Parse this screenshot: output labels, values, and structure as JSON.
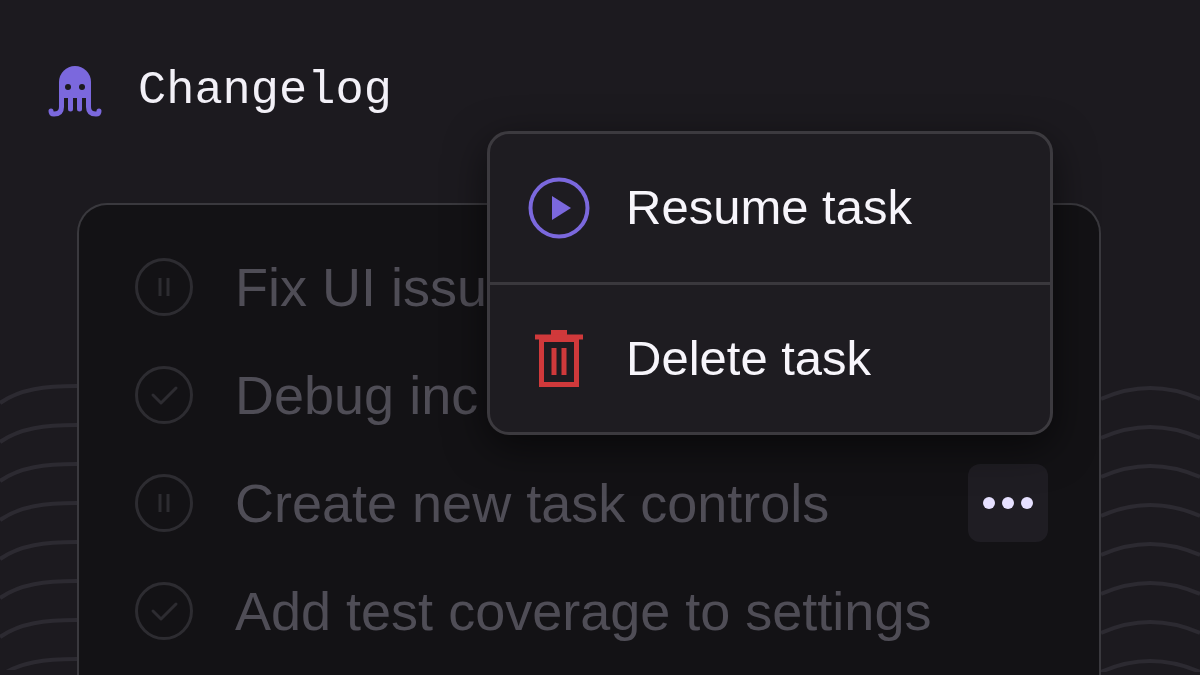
{
  "header": {
    "title": "Changelog"
  },
  "tasks": [
    {
      "title": "Fix UI issu",
      "kind": "paused",
      "hovered": false
    },
    {
      "title": "Debug inc",
      "kind": "done",
      "hovered": false
    },
    {
      "title": "Create new task controls",
      "kind": "paused",
      "hovered": true
    },
    {
      "title": "Add test coverage to settings",
      "kind": "done",
      "hovered": false
    }
  ],
  "context_menu": {
    "items": [
      {
        "label": "Resume task",
        "kind": "resume"
      },
      {
        "label": "Delete task",
        "kind": "delete"
      }
    ]
  }
}
